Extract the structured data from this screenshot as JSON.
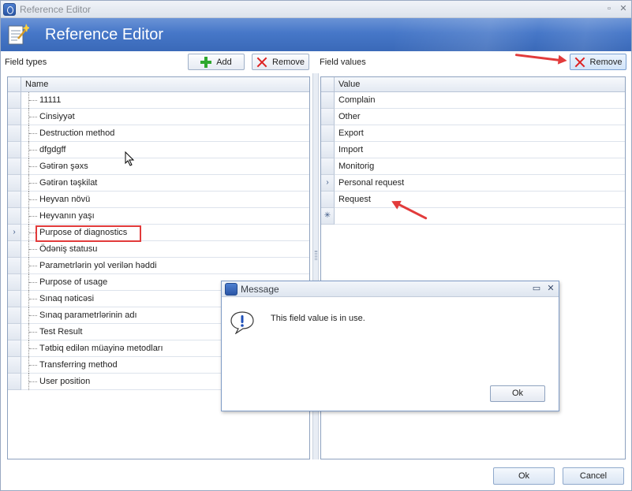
{
  "window": {
    "title": "Reference Editor",
    "controls": {
      "maximize": "▫",
      "close": "✕"
    }
  },
  "banner": {
    "heading": "Reference Editor"
  },
  "field_types": {
    "label": "Field types",
    "add_label": "Add",
    "remove_label": "Remove",
    "column": "Name",
    "selected_index": 8,
    "items": [
      "11111",
      "Cinsiyyət",
      "Destruction method",
      "dfgdgff",
      "Gətirən şəxs",
      "Gətirən təşkilat",
      "Heyvan növü",
      "Heyvanın yaşı",
      "Purpose of diagnostics",
      "Ödəniş statusu",
      "Parametrlərin yol verilən həddi",
      "Purpose of usage",
      "Sınaq nəticəsi",
      "Sınaq parametrlərinin adı",
      "Test Result",
      "Tətbiq edilən müayinə metodları",
      "Transferring method",
      "User position"
    ]
  },
  "field_values": {
    "label": "Field values",
    "remove_label": "Remove",
    "column": "Value",
    "selected_index": 5,
    "new_row_marker": "✳",
    "items": [
      "Complain",
      "Other",
      "Export",
      "Import",
      "Monitorig",
      "Personal request",
      "Request"
    ]
  },
  "row_indicator": "›",
  "footer": {
    "ok_label": "Ok",
    "cancel_label": "Cancel"
  },
  "dialog": {
    "title": "Message",
    "message": "This field value is in use.",
    "ok_label": "Ok",
    "controls": {
      "maximize": "▭",
      "close": "✕"
    }
  },
  "colors": {
    "accent": "#4677c8",
    "annotation": "#e23b3b",
    "add_icon": "#2ea82e"
  },
  "icons": [
    "app-icon",
    "document-wand-icon",
    "plus-icon",
    "remove-x-icon",
    "info-exclamation-icon",
    "mouse-cursor-icon"
  ]
}
